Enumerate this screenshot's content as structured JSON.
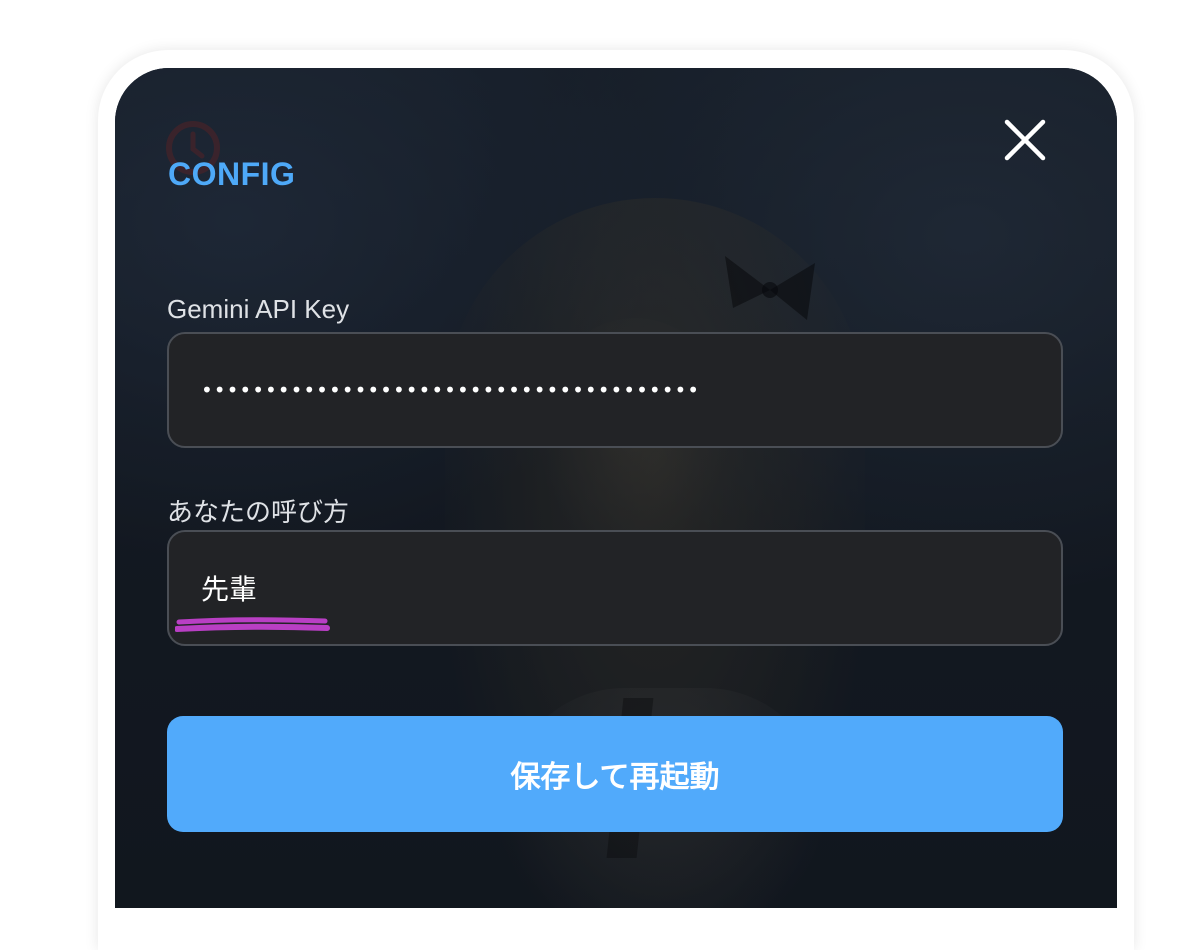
{
  "config_dialog": {
    "title": "CONFIG",
    "close_icon": "close-icon",
    "api_key": {
      "label": "Gemini API Key",
      "value": "•••••••••••••••••••••••••••••••••••••••"
    },
    "nickname": {
      "label": "あなたの呼び方",
      "value": "先輩",
      "annotation_color": "#b93fc4"
    },
    "save_button_label": "保存して再起動"
  },
  "colors": {
    "accent": "#51aafb",
    "title": "#4ea9f8",
    "input_background": "#222326",
    "input_border": "#4a4e55",
    "overlay_background": "#141a22"
  },
  "background": {
    "clock_icon": "clock-icon",
    "bow_icon": "bow-icon"
  }
}
